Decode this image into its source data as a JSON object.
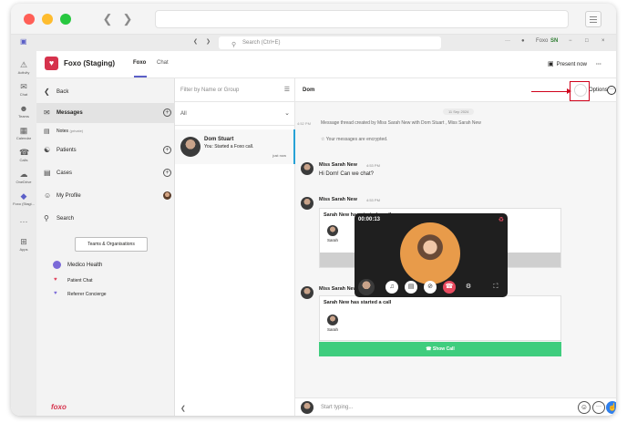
{
  "browser": {
    "back_icon": "chevron-left-icon",
    "forward_icon": "chevron-right-icon"
  },
  "teams": {
    "search_placeholder": "Search (Ctrl+E)",
    "org_label": "Foxo",
    "user_initials": "SN",
    "rail": [
      {
        "label": "Activity",
        "icon": "bell-icon"
      },
      {
        "label": "Chat",
        "icon": "chat-icon"
      },
      {
        "label": "Teams",
        "icon": "teams-icon"
      },
      {
        "label": "Calendar",
        "icon": "calendar-icon"
      },
      {
        "label": "Calls",
        "icon": "phone-icon"
      },
      {
        "label": "OneDrive",
        "icon": "cloud-icon"
      },
      {
        "label": "Foxo (Stagi...",
        "icon": "foxo-icon"
      },
      {
        "label": "",
        "icon": "more-icon"
      },
      {
        "label": "Apps",
        "icon": "apps-icon"
      }
    ]
  },
  "app": {
    "title": "Foxo (Staging)",
    "tabs": [
      "Foxo",
      "Chat"
    ],
    "present_label": "Present now",
    "nav": {
      "back": "Back",
      "messages": "Messages",
      "notes": "Notes",
      "notes_badge": "(private)",
      "patients": "Patients",
      "cases": "Cases",
      "my_profile": "My Profile",
      "search": "Search",
      "teams_button": "Teams & Organisations",
      "orgs": [
        {
          "name": "Medico Health"
        },
        {
          "name": "Patient Chat"
        },
        {
          "name": "Referrer Concierge"
        }
      ],
      "brand": "foxo"
    }
  },
  "list": {
    "filter_placeholder": "Filter by Name or Group",
    "all_label": "All",
    "contact": {
      "name": "Dom Stuart",
      "preview": "You: Started a Foxo call.",
      "time": "just now"
    }
  },
  "chat": {
    "title": "Dom",
    "options_label": "Options",
    "date": "11 Sep 2024",
    "system_time": "4:52 PM",
    "thread_created": "Message thread created by Miss Sarah New with Dom Stuart , Miss Sarah New",
    "encrypted": "Your messages are encrypted.",
    "messages": [
      {
        "sender": "Miss Sarah New",
        "time": "4:53 PM",
        "text": "Hi Dom! Can we chat?"
      },
      {
        "sender": "Miss Sarah New",
        "time": "4:53 PM",
        "card_title": "Sarah New has started a call",
        "participant": "Sarah"
      },
      {
        "sender": "Miss Sarah New",
        "time": "4:53 PM",
        "card_title": "Sarah New has started a call",
        "participant": "Sarah",
        "button": "Show Call"
      }
    ],
    "composer_placeholder": "Start typing..."
  },
  "call": {
    "timer": "00:00:13"
  },
  "colors": {
    "brand": "#d6324c",
    "teams_purple": "#5b5fc7",
    "call_green": "#3fcd7e",
    "end_call": "#e84a5f",
    "annotation": "#d0021b"
  }
}
